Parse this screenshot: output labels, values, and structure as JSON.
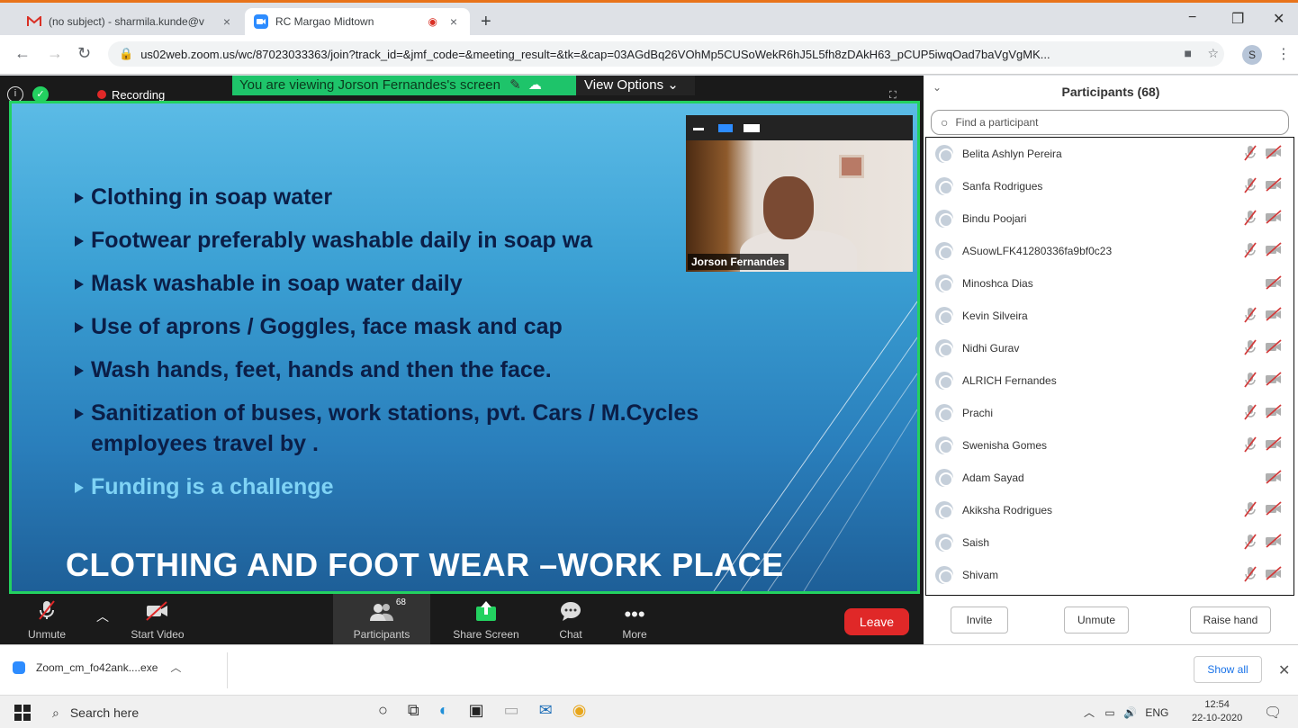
{
  "browser": {
    "tabs": [
      {
        "title": "(no subject) - sharmila.kunde@v",
        "active": false,
        "close": "×"
      },
      {
        "title": "RC Margao Midtown",
        "active": true,
        "close": "×"
      }
    ],
    "new_tab": "+",
    "window_controls": {
      "minimize": "−",
      "restore": "❐",
      "close": "✕"
    },
    "url": "us02web.zoom.us/wc/87023033363/join?track_id=&jmf_code=&meeting_result=&tk=&cap=03AGdBq26VOhMp5CUSoWekR6hJ5L5fh8zDAkH63_pCUP5iwqOad7baVgVgMK...",
    "profile_initial": "S"
  },
  "meeting": {
    "recording_label": "Recording",
    "viewing_banner": "You are viewing Jorson Fernandes's screen",
    "view_options": "View Options",
    "slide": {
      "bullets": [
        "Clothing in soap water",
        "Footwear preferably washable daily in soap wa",
        "Mask washable in soap water daily",
        "Use of aprons / Goggles, face mask and cap",
        "Wash hands,  feet, hands and then the face.",
        "Sanitization of buses, work stations, pvt. Cars / M.Cycles",
        "employees travel by .",
        "Funding is a challenge"
      ],
      "title": "CLOTHING AND FOOT WEAR –WORK PLACE"
    },
    "camera": {
      "name": "Jorson Fernandes"
    },
    "toolbar": {
      "unmute": "Unmute",
      "start_video": "Start Video",
      "participants": "Participants",
      "participants_count": "68",
      "share_screen": "Share Screen",
      "chat": "Chat",
      "more": "More",
      "leave": "Leave"
    }
  },
  "panel": {
    "title": "Participants (68)",
    "search_placeholder": "Find a participant",
    "participants": [
      {
        "name": "Belita Ashlyn Pereira",
        "mic_muted": true
      },
      {
        "name": "Sanfa Rodrigues",
        "mic_muted": true
      },
      {
        "name": "Bindu Poojari",
        "mic_muted": true
      },
      {
        "name": "ASuowLFK41280336fa9bf0c23",
        "mic_muted": true
      },
      {
        "name": "Minoshca Dias",
        "mic_muted": false
      },
      {
        "name": "Kevin Silveira",
        "mic_muted": true
      },
      {
        "name": "Nidhi Gurav",
        "mic_muted": true
      },
      {
        "name": "ALRICH Fernandes",
        "mic_muted": true
      },
      {
        "name": "Prachi",
        "mic_muted": true
      },
      {
        "name": "Swenisha Gomes",
        "mic_muted": true
      },
      {
        "name": "Adam Sayad",
        "mic_muted": false
      },
      {
        "name": "Akiksha Rodrigues",
        "mic_muted": true
      },
      {
        "name": "Saish",
        "mic_muted": true
      },
      {
        "name": "Shivam",
        "mic_muted": true
      }
    ],
    "buttons": {
      "invite": "Invite",
      "unmute": "Unmute",
      "raise_hand": "Raise hand"
    }
  },
  "downloads": {
    "file": "Zoom_cm_fo42ank....exe",
    "show_all": "Show all"
  },
  "taskbar": {
    "search": "Search here",
    "language": "ENG",
    "time": "12:54",
    "date": "22-10-2020"
  },
  "colors": {
    "accent_green": "#23d160",
    "leave_red": "#e02828",
    "zoom_blue": "#2d8cff"
  }
}
